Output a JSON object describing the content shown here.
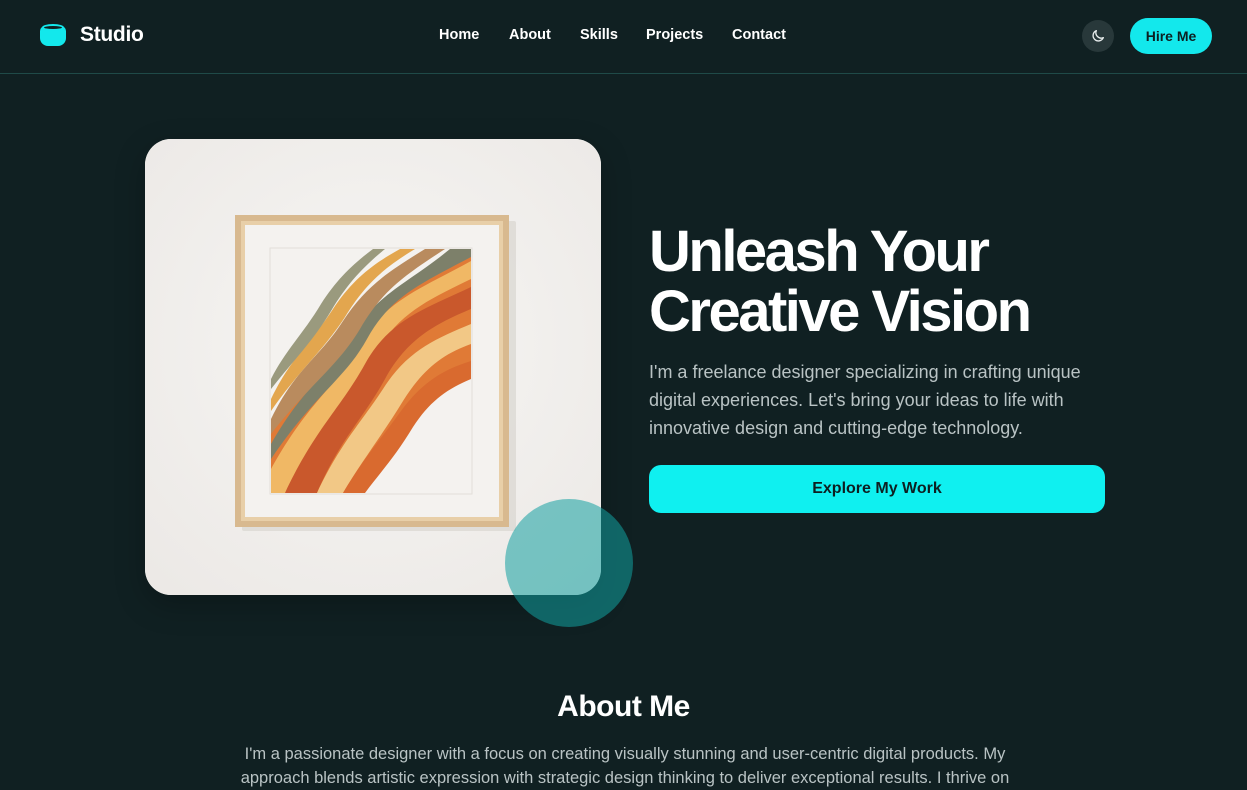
{
  "header": {
    "logo_text": "Studio",
    "nav": [
      "Home",
      "About",
      "Skills",
      "Projects",
      "Contact"
    ],
    "hire_label": "Hire Me",
    "theme_icon": "moon-icon"
  },
  "hero": {
    "title_line1": "Unleash Your",
    "title_line2": "Creative Vision",
    "subtitle": "I'm a freelance designer specializing in crafting unique digital experiences. Let's bring your ideas to life with innovative design and cutting-edge technology.",
    "cta_label": "Explore My Work"
  },
  "about": {
    "title": "About Me",
    "text": "I'm a passionate designer with a focus on creating visually stunning and user-centric digital products. My approach blends artistic expression with strategic design thinking to deliver exceptional results. I thrive on"
  },
  "colors": {
    "background": "#102022",
    "accent": "#13e8ec",
    "muted_text": "#b9c3c4"
  }
}
